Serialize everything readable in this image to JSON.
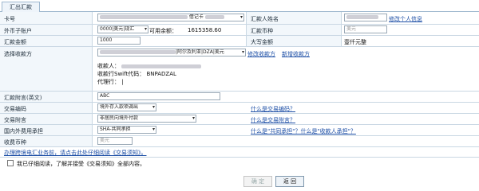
{
  "tab": {
    "label": "汇出汇款"
  },
  "fields": {
    "card_no_label": "卡号",
    "card_no_value": "借记卡",
    "remitter_name_label": "汇款人姓名",
    "edit_personal_info": "修改个人信息",
    "fx_account_label": "外币子账户",
    "fx_account_value": "0000|美元|现汇",
    "available_balance_label": "可用余额：",
    "available_balance_value": "1615358.60",
    "remit_currency_label": "汇款币种",
    "remit_currency_value": "美元",
    "amount_label": "汇款金额",
    "amount_value": "1000",
    "amount_upper_label": "大写金额",
    "amount_upper_value": "壹仟元整",
    "select_payee_label": "选择收款方",
    "payee_select_value": "|阿尔及利亚|DZA|美元",
    "edit_payee": "修改收款方",
    "new_payee": "新增收款方",
    "payee_label": "收款人：",
    "payee_bank_swift_label": "收款行Swift代码：",
    "payee_bank_swift_value": "BNPADZAL",
    "agent_bank_label": "代理行：",
    "agent_bank_value": "|",
    "postscript_label": "汇款附言(英文)",
    "postscript_value": "ABC",
    "tx_code_label": "交易编码",
    "tx_code_value": "境外存入款项调出",
    "what_tx_code": "什么是交易编码？",
    "tx_postscript_label": "交易附言",
    "tx_postscript_value": "非居民向境外付款",
    "what_tx_postscript": "什么是交易附言？",
    "domestic_fee_label": "国内外费用承担",
    "domestic_fee_value": "SHA-共同承担",
    "what_fee": "什么是\"共同承担\"？什么是\"收款人承担\"？",
    "fee_currency_label": "收费币种",
    "fee_currency_value": "美元"
  },
  "notice_link": "办理跨境电汇业务前，请点击此处仔细阅读《交易须知》。",
  "agreement": {
    "text": "我已仔细阅读，了解并接受《交易须知》全部内容。"
  },
  "buttons": {
    "confirm": "确 定",
    "back": "返 回"
  }
}
